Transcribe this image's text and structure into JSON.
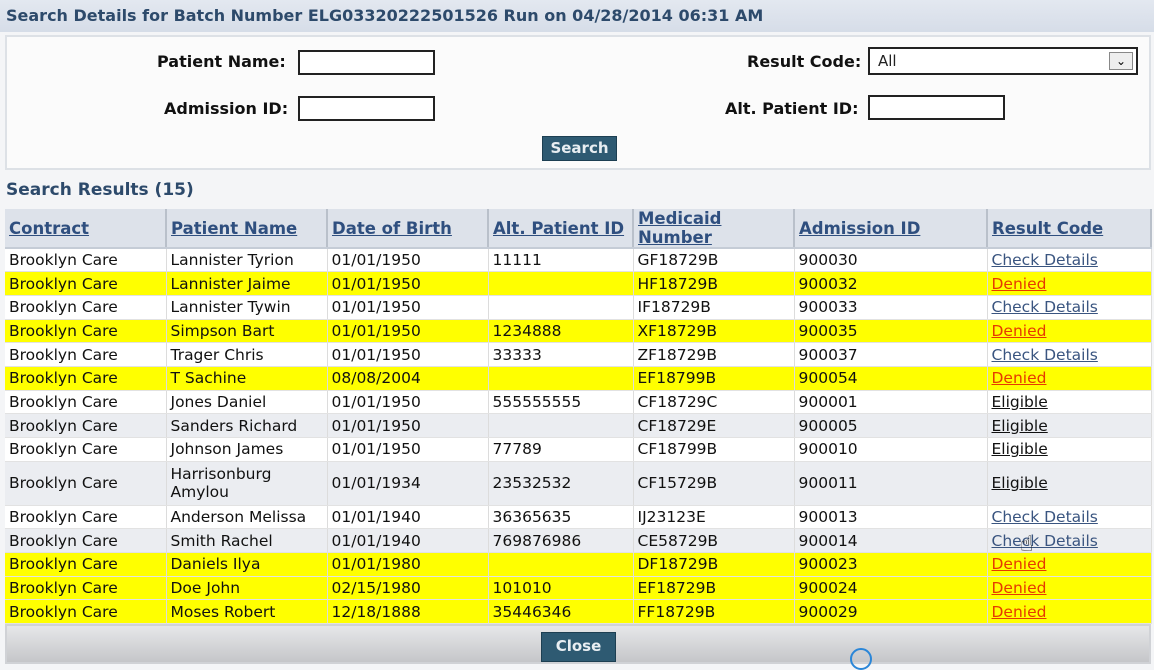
{
  "title": "Search Details for Batch Number ELG03320222501526 Run on 04/28/2014 06:31 AM",
  "search_form": {
    "patient_name_label": "Patient Name:",
    "patient_name_value": "",
    "admission_id_label": "Admission ID:",
    "admission_id_value": "",
    "result_code_label": "Result Code:",
    "result_code_selected": "All",
    "alt_patient_id_label": "Alt. Patient ID:",
    "alt_patient_id_value": "",
    "search_button": "Search"
  },
  "results": {
    "heading": "Search Results (15)",
    "count": 15,
    "columns": [
      "Contract",
      "Patient Name",
      "Date of Birth",
      "Alt. Patient ID",
      "Medicaid Number",
      "Admission ID",
      "Result Code"
    ],
    "rows": [
      {
        "contract": "Brooklyn Care",
        "patient_name": "Lannister Tyrion",
        "dob": "01/01/1950",
        "alt_id": "11111",
        "medicaid": "GF18729B",
        "admission_id": "900030",
        "result": "Check Details",
        "status": "check"
      },
      {
        "contract": "Brooklyn Care",
        "patient_name": "Lannister Jaime",
        "dob": "01/01/1950",
        "alt_id": "",
        "medicaid": "HF18729B",
        "admission_id": "900032",
        "result": "Denied",
        "status": "denied"
      },
      {
        "contract": "Brooklyn Care",
        "patient_name": "Lannister Tywin",
        "dob": "01/01/1950",
        "alt_id": "",
        "medicaid": "IF18729B",
        "admission_id": "900033",
        "result": "Check Details",
        "status": "check"
      },
      {
        "contract": "Brooklyn Care",
        "patient_name": "Simpson Bart",
        "dob": "01/01/1950",
        "alt_id": "1234888",
        "medicaid": "XF18729B",
        "admission_id": "900035",
        "result": "Denied",
        "status": "denied"
      },
      {
        "contract": "Brooklyn Care",
        "patient_name": "Trager Chris",
        "dob": "01/01/1950",
        "alt_id": "33333",
        "medicaid": "ZF18729B",
        "admission_id": "900037",
        "result": "Check Details",
        "status": "check"
      },
      {
        "contract": "Brooklyn Care",
        "patient_name": "T Sachine",
        "dob": "08/08/2004",
        "alt_id": "",
        "medicaid": "EF18799B",
        "admission_id": "900054",
        "result": "Denied",
        "status": "denied"
      },
      {
        "contract": "Brooklyn Care",
        "patient_name": "Jones Daniel",
        "dob": "01/01/1950",
        "alt_id": "555555555",
        "medicaid": "CF18729C",
        "admission_id": "900001",
        "result": "Eligible",
        "status": "eligible"
      },
      {
        "contract": "Brooklyn Care",
        "patient_name": "Sanders Richard",
        "dob": "01/01/1950",
        "alt_id": "",
        "medicaid": "CF18729E",
        "admission_id": "900005",
        "result": "Eligible",
        "status": "eligible"
      },
      {
        "contract": "Brooklyn Care",
        "patient_name": "Johnson James",
        "dob": "01/01/1950",
        "alt_id": "77789",
        "medicaid": "CF18799B",
        "admission_id": "900010",
        "result": "Eligible",
        "status": "eligible"
      },
      {
        "contract": "Brooklyn Care",
        "patient_name": "Harrisonburg Amylou",
        "dob": "01/01/1934",
        "alt_id": "23532532",
        "medicaid": "CF15729B",
        "admission_id": "900011",
        "result": "Eligible",
        "status": "eligible"
      },
      {
        "contract": "Brooklyn Care",
        "patient_name": "Anderson Melissa",
        "dob": "01/01/1940",
        "alt_id": "36365635",
        "medicaid": "IJ23123E",
        "admission_id": "900013",
        "result": "Check Details",
        "status": "check"
      },
      {
        "contract": "Brooklyn Care",
        "patient_name": "Smith Rachel",
        "dob": "01/01/1940",
        "alt_id": "769876986",
        "medicaid": "CE58729B",
        "admission_id": "900014",
        "result": "Check Details",
        "status": "check"
      },
      {
        "contract": "Brooklyn Care",
        "patient_name": "Daniels Ilya",
        "dob": "01/01/1980",
        "alt_id": "",
        "medicaid": "DF18729B",
        "admission_id": "900023",
        "result": "Denied",
        "status": "denied"
      },
      {
        "contract": "Brooklyn Care",
        "patient_name": "Doe John",
        "dob": "02/15/1980",
        "alt_id": "101010",
        "medicaid": "EF18729B",
        "admission_id": "900024",
        "result": "Denied",
        "status": "denied"
      },
      {
        "contract": "Brooklyn Care",
        "patient_name": "Moses Robert",
        "dob": "12/18/1888",
        "alt_id": "35446346",
        "medicaid": "FF18729B",
        "admission_id": "900029",
        "result": "Denied",
        "status": "denied"
      }
    ]
  },
  "footer": {
    "close_button": "Close"
  },
  "colors": {
    "denied_row": "#ffff00",
    "denied_link": "#e63a00",
    "check_link": "#3a5580",
    "header_text": "#2d4a6b",
    "button_bg": "#2e5a72"
  },
  "icons": {
    "dropdown": "chevron-down-icon",
    "cursor": "hand-pointer-icon",
    "spinner": "loading-spinner-icon"
  }
}
